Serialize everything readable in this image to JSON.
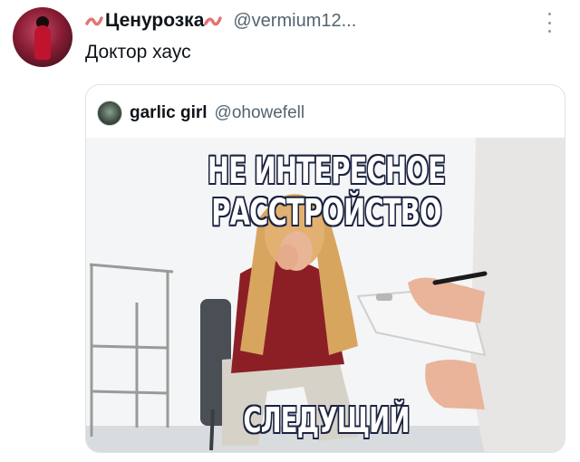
{
  "tweet": {
    "display_name": "Ценурозка",
    "handle": "@vermium12...",
    "text": "Доктор хаус",
    "more_icon": "more-vertical-icon"
  },
  "quoted_tweet": {
    "display_name": "garlic girl",
    "handle": "@ohowefell"
  },
  "meme": {
    "top_caption": "НЕ ИНТЕРЕСНОЕ РАССТРОЙСТВО",
    "bottom_caption": "СЛЕДУЩИЙ"
  },
  "colors": {
    "name_emoji": "#e57373",
    "secondary_text": "#536471",
    "border": "#dde3e8"
  }
}
